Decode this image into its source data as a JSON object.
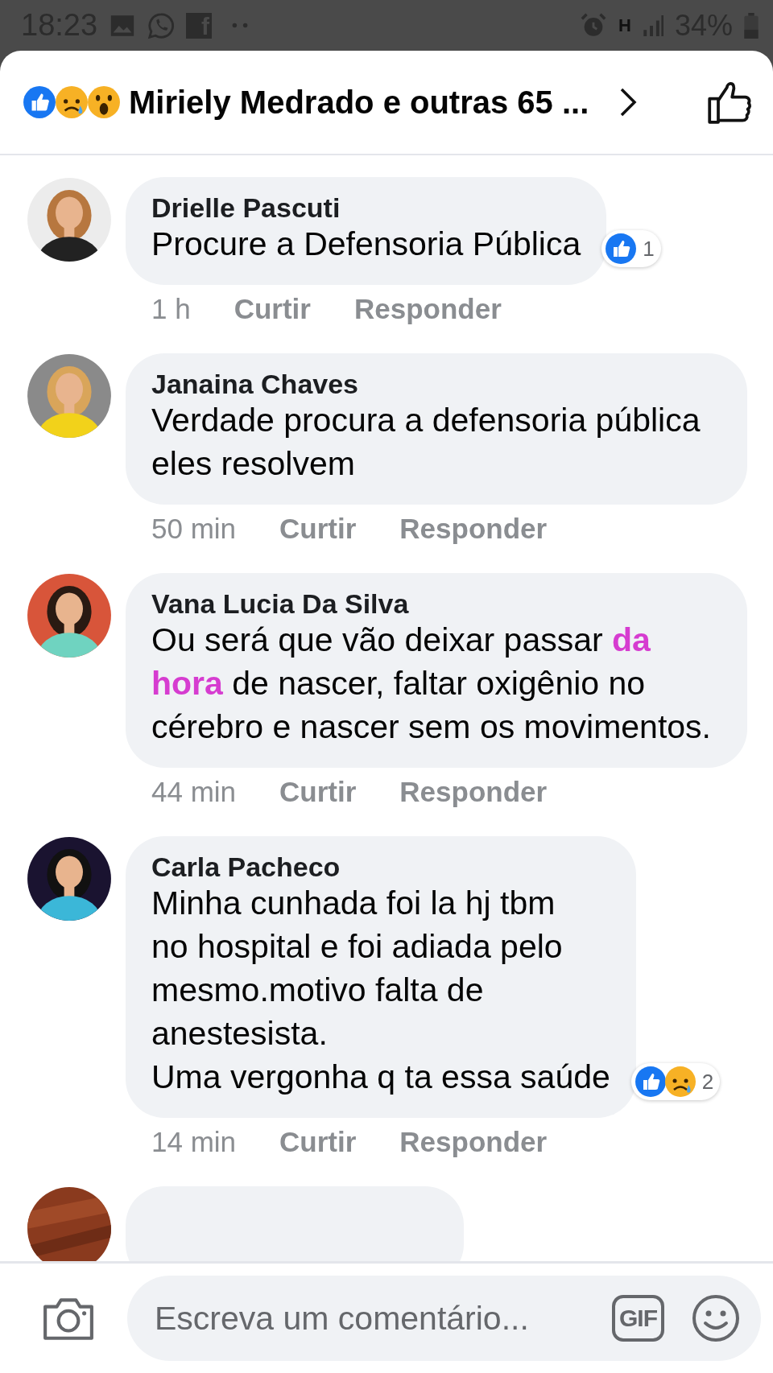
{
  "status_bar": {
    "time": "18:23",
    "app_letter": "f",
    "network_letter": "H",
    "battery": "34%"
  },
  "header": {
    "reactions": [
      {
        "kind": "like"
      },
      {
        "kind": "sad"
      },
      {
        "kind": "wow"
      }
    ],
    "title": "Miriely Medrado e outras 65 ..."
  },
  "comments": [
    {
      "author": "Drielle Pascuti",
      "parts": [
        {
          "text": "Procure a Defensoria Pública",
          "highlight": false
        }
      ],
      "reactions": [
        {
          "kind": "like"
        }
      ],
      "reaction_count": "1",
      "time": "1 h",
      "like": "Curtir",
      "reply": "Responder"
    },
    {
      "author": "Janaina Chaves",
      "parts": [
        {
          "text": "Verdade procura a defensoria pública eles resolvem",
          "highlight": false
        }
      ],
      "time": "50 min",
      "like": "Curtir",
      "reply": "Responder"
    },
    {
      "author": "Vana Lucia Da Silva",
      "parts": [
        {
          "text": "Ou será que vão deixar passar ",
          "highlight": false
        },
        {
          "text": "da hora",
          "highlight": true
        },
        {
          "text": " de nascer, faltar oxigênio no cérebro e nascer sem os movimentos.",
          "highlight": false
        }
      ],
      "time": "44 min",
      "like": "Curtir",
      "reply": "Responder"
    },
    {
      "author": "Carla Pacheco",
      "parts": [
        {
          "text": "Minha cunhada foi la hj tbm\nno hospital e foi adiada pelo\nmesmo.motivo falta de\nanestesista.\nUma vergonha q ta essa saúde",
          "highlight": false
        }
      ],
      "reactions": [
        {
          "kind": "like"
        },
        {
          "kind": "sad"
        }
      ],
      "reaction_count": "2",
      "time": "14 min",
      "like": "Curtir",
      "reply": "Responder"
    }
  ],
  "composer": {
    "placeholder": "Escreva um comentário...",
    "gif_label": "GIF"
  }
}
